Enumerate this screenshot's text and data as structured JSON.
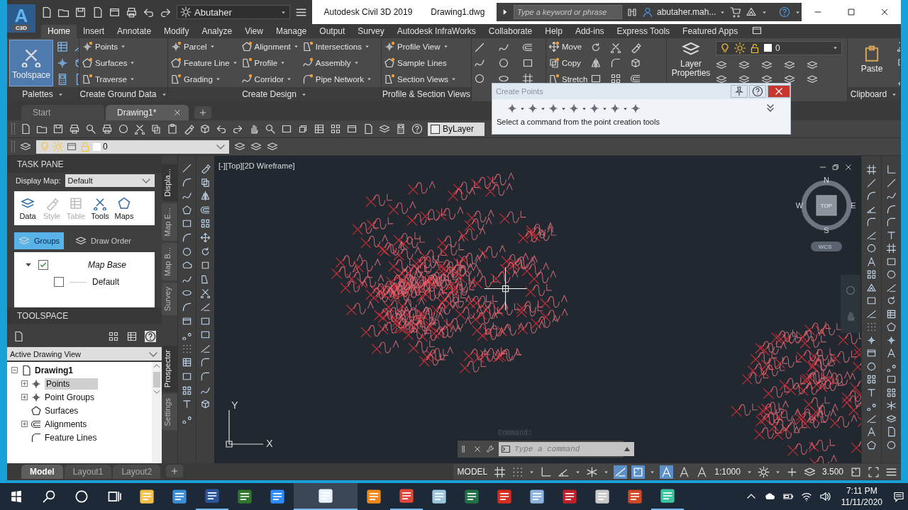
{
  "app_logo": {
    "letter": "A",
    "sub": "C3D"
  },
  "workspace": "Abutaher",
  "title": {
    "app": "Autodesk Civil 3D 2019",
    "file": "Drawing1.dwg"
  },
  "search": {
    "placeholder": "Type a keyword or phrase"
  },
  "user": "abutaher.mah...",
  "ribbon_tabs": [
    {
      "label": "Home",
      "selected": true
    },
    {
      "label": "Insert",
      "selected": false
    },
    {
      "label": "Annotate",
      "selected": false
    },
    {
      "label": "Modify",
      "selected": false
    },
    {
      "label": "Analyze",
      "selected": false
    },
    {
      "label": "View",
      "selected": false
    },
    {
      "label": "Manage",
      "selected": false
    },
    {
      "label": "Output",
      "selected": false
    },
    {
      "label": "Survey",
      "selected": false
    },
    {
      "label": "Autodesk InfraWorks",
      "selected": false
    },
    {
      "label": "Collaborate",
      "selected": false
    },
    {
      "label": "Help",
      "selected": false
    },
    {
      "label": "Add-ins",
      "selected": false
    },
    {
      "label": "Express Tools",
      "selected": false
    },
    {
      "label": "Featured Apps",
      "selected": false
    }
  ],
  "ribbon_panels": [
    {
      "kind": "palettes",
      "title": "Palettes",
      "big": {
        "label": "Toolspace",
        "selected": true
      }
    },
    {
      "kind": "list",
      "title": "Create Ground Data",
      "columns": [
        [
          {
            "label": "Points",
            "dropdown": true
          },
          {
            "label": "Surfaces",
            "dropdown": true
          },
          {
            "label": "Traverse",
            "dropdown": true
          }
        ]
      ]
    },
    {
      "kind": "list",
      "title": "Create Design",
      "columns": [
        [
          {
            "label": "Parcel",
            "dropdown": true
          },
          {
            "label": "Feature Line",
            "dropdown": true
          },
          {
            "label": "Grading",
            "dropdown": true
          }
        ],
        [
          {
            "label": "Alignment",
            "dropdown": true
          },
          {
            "label": "Profile",
            "dropdown": true
          },
          {
            "label": "Corridor",
            "dropdown": true
          }
        ],
        [
          {
            "label": "Intersections",
            "dropdown": true
          },
          {
            "label": "Assembly",
            "dropdown": true
          },
          {
            "label": "Pipe Network",
            "dropdown": true
          }
        ]
      ]
    },
    {
      "kind": "list",
      "title": "Profile & Section Views",
      "columns": [
        [
          {
            "label": "Profile View",
            "dropdown": true
          },
          {
            "label": "Sample Lines",
            "dropdown": false
          },
          {
            "label": "Section Views",
            "dropdown": true
          }
        ]
      ]
    },
    {
      "kind": "draw"
    },
    {
      "kind": "modify",
      "columns": [
        [
          {
            "label": "Move",
            "dropdown": false
          },
          {
            "label": "Copy",
            "dropdown": false
          },
          {
            "label": "Stretch",
            "dropdown": false
          }
        ]
      ]
    },
    {
      "kind": "layers",
      "big": {
        "label": "Layer Properties",
        "selected": false
      },
      "layer": "0"
    },
    {
      "kind": "clipboard",
      "title": "Clipboard",
      "big": {
        "label": "Paste",
        "selected": false
      }
    }
  ],
  "document_tabs": [
    {
      "label": "Start",
      "selected": false,
      "closable": false
    },
    {
      "label": "Drawing1*",
      "selected": true,
      "closable": true
    }
  ],
  "toolbar": {
    "linetype": "ByLayer"
  },
  "layer_toolbar": {
    "layer": "0"
  },
  "task_pane": {
    "title": "TASK PANE",
    "display_map_label": "Display Map:",
    "display_map": "Default",
    "tools": [
      {
        "label": "Data",
        "disabled": false
      },
      {
        "label": "Style",
        "disabled": true
      },
      {
        "label": "Table",
        "disabled": true
      },
      {
        "label": "Tools",
        "disabled": false
      },
      {
        "label": "Maps",
        "disabled": false
      }
    ],
    "views": [
      {
        "label": "Groups",
        "selected": true
      },
      {
        "label": "Draw Order",
        "selected": false
      }
    ],
    "tree": [
      {
        "label": "Map Base",
        "checked": true,
        "expanded": true,
        "children": [
          {
            "label": "Default",
            "checked": false
          }
        ]
      }
    ]
  },
  "side_tabs_top": [
    {
      "label": "Displa...",
      "selected": true
    },
    {
      "label": "Map E...",
      "selected": false
    },
    {
      "label": "Map B...",
      "selected": false
    },
    {
      "label": "Survey",
      "selected": false
    }
  ],
  "toolspace": {
    "title": "TOOLSPACE",
    "view": "Active Drawing View",
    "tree": [
      {
        "label": "Drawing1",
        "expanded": true,
        "selected": false,
        "children": [
          {
            "label": "Points",
            "expandable": true,
            "selected": true
          },
          {
            "label": "Point Groups",
            "expandable": true,
            "selected": false
          },
          {
            "label": "Surfaces",
            "expandable": false,
            "selected": false
          },
          {
            "label": "Alignments",
            "expandable": true,
            "selected": false
          },
          {
            "label": "Feature Lines",
            "expandable": false,
            "selected": false
          }
        ]
      }
    ]
  },
  "side_tabs_bottom": [
    {
      "label": "Prospector",
      "selected": true
    },
    {
      "label": "Settings",
      "selected": false
    }
  ],
  "viewport": {
    "label": "[-][Top][2D Wireframe]",
    "viewcube": {
      "top": "TOP",
      "n": "N",
      "s": "S",
      "e": "E",
      "w": "W",
      "ucs": "WCS"
    },
    "axes": {
      "x": "X",
      "y": "Y"
    }
  },
  "command": {
    "history": "Command:",
    "placeholder": "Type a command"
  },
  "create_points": {
    "title": "Create Points",
    "status": "Select a command from the point creation tools"
  },
  "layout_tabs": [
    {
      "label": "Model",
      "selected": true
    },
    {
      "label": "Layout1",
      "selected": false
    },
    {
      "label": "Layout2",
      "selected": false
    }
  ],
  "status_bar": {
    "space": "MODEL",
    "scale": "1:1000",
    "lineweight": "3.500",
    "toggles": [
      {
        "kind": "grid",
        "on": false
      },
      {
        "kind": "snap",
        "on": false
      },
      {
        "kind": "ortho",
        "on": false
      },
      {
        "kind": "polar",
        "on": false
      },
      {
        "kind": "iso",
        "on": false
      },
      {
        "kind": "otrack",
        "on": true
      },
      {
        "kind": "osnap",
        "on": true
      },
      {
        "kind": "annovis",
        "on": true
      },
      {
        "kind": "autoscale",
        "on": false
      },
      {
        "kind": "annoscale",
        "on": false
      }
    ]
  },
  "taskbar": {
    "time": "7:11 PM",
    "date": "11/11/2020",
    "apps": [
      {
        "kind": "start",
        "running": false,
        "selected": false
      },
      {
        "kind": "search",
        "running": false,
        "selected": false
      },
      {
        "kind": "cortana",
        "running": false,
        "selected": false
      },
      {
        "kind": "taskview",
        "running": false,
        "selected": false
      },
      {
        "kind": "explorer",
        "running": false,
        "selected": false
      },
      {
        "kind": "remote",
        "running": false,
        "selected": false
      },
      {
        "kind": "word",
        "running": true,
        "selected": false
      },
      {
        "kind": "project",
        "running": false,
        "selected": false
      },
      {
        "kind": "meeting",
        "running": false,
        "selected": false
      },
      {
        "kind": "autocad",
        "running": true,
        "selected": true
      },
      {
        "kind": "vlc",
        "running": false,
        "selected": false
      },
      {
        "kind": "chrome",
        "running": true,
        "selected": false
      },
      {
        "kind": "notepad",
        "running": false,
        "selected": false
      },
      {
        "kind": "excel",
        "running": false,
        "selected": false
      },
      {
        "kind": "acrobat",
        "running": false,
        "selected": false
      },
      {
        "kind": "virtualbox",
        "running": false,
        "selected": false
      },
      {
        "kind": "pdf",
        "running": false,
        "selected": false
      },
      {
        "kind": "calculator",
        "running": false,
        "selected": false
      },
      {
        "kind": "powerpoint",
        "running": false,
        "selected": false
      },
      {
        "kind": "editor",
        "running": true,
        "selected": false
      }
    ]
  }
}
